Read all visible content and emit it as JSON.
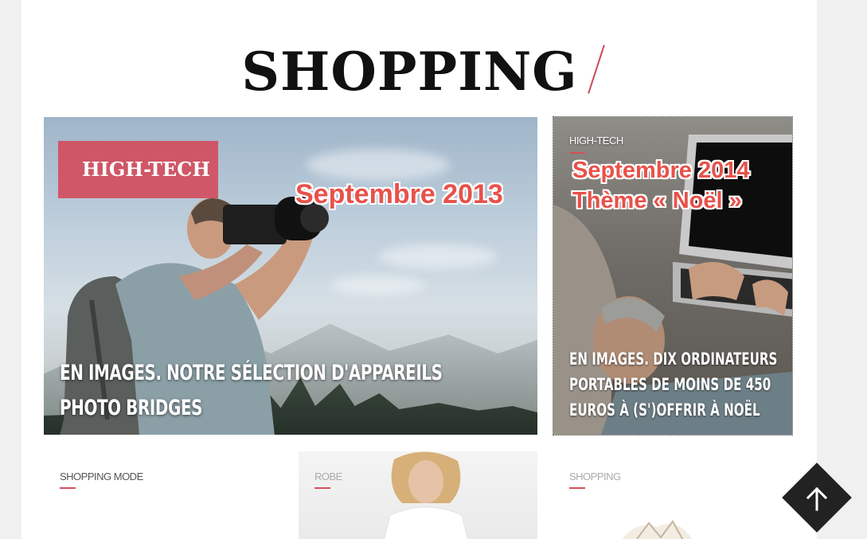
{
  "section": {
    "title": "SHOPPING"
  },
  "featured": {
    "tag": "HIGH-TECH",
    "overlay_date": "Septembre 2013",
    "headline_line1": "EN IMAGES. NOTRE SÉLECTION D'APPAREILS",
    "headline_line2": "PHOTO BRIDGES"
  },
  "side_article": {
    "category": "HIGH-TECH",
    "overlay_line1": "Septembre 2014",
    "overlay_line2": "Thème « Noël »",
    "headline_line1": "EN IMAGES. DIX ORDINATEURS",
    "headline_line2": "PORTABLES DE MOINS DE 450",
    "headline_line3": "EUROS À (S')OFFRIR À NOËL"
  },
  "bottom_cards": [
    {
      "category": "SHOPPING MODE"
    },
    {
      "category": "ROBE"
    },
    {
      "category": "SHOPPING"
    }
  ],
  "colors": {
    "accent": "#d4505d",
    "overlay_red": "#e8514a",
    "badge": "#d44858"
  },
  "icons": {
    "back_to_top": "arrow-up-icon"
  }
}
